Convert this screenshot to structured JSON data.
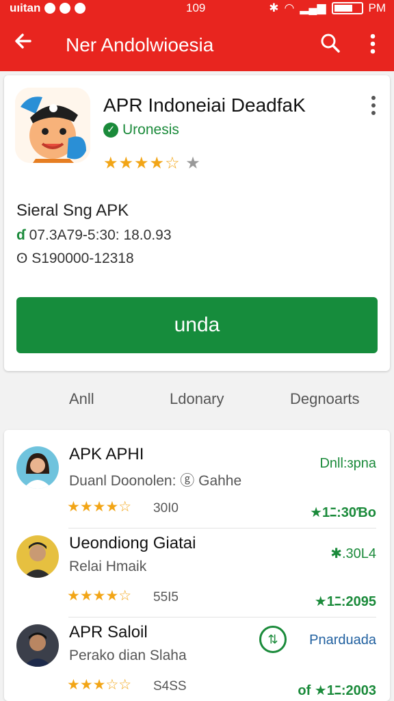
{
  "status_bar": {
    "left": "uıitan",
    "time": "109",
    "right": "PM"
  },
  "app_bar": {
    "title": "Ner Andolwioesia"
  },
  "app": {
    "name": "APR Indoneiai DeadfaK",
    "developer": "Uronesis",
    "rating": 4.5,
    "stars": "★★★★☆",
    "extra_star": "★"
  },
  "details": {
    "subtitle": "Sieral Sng APK",
    "meta1_icon": "ɗ",
    "meta1": "07.3A79-5:30: 18.0.93",
    "meta2_icon": "ʘ",
    "meta2": "S190000-12318"
  },
  "install_button": "unda",
  "tabs": [
    "Anll",
    "Ldonary",
    "Degnoarts"
  ],
  "list": [
    {
      "title": "APK APHI",
      "subtitle": "Duanl Doonolen: ⓖ Gahhe",
      "stars": "★★★★☆",
      "rating_count": "30I0",
      "right_label": "Dnll:ɜpna",
      "right_rating": "★1ﾆ:30Ɓo"
    },
    {
      "title": "Ueondiong Giatai",
      "subtitle": "Relai Hmaik",
      "stars": "★★★★☆",
      "rating_count": "55I5",
      "right_label": "✱.30L4",
      "right_rating": "★1ﾆ:2095"
    },
    {
      "title": "APR Saloil",
      "subtitle": "Perako dian Slaha",
      "stars": "★★★☆☆",
      "rating_count": "S4SS",
      "right_label": "Pnarduada",
      "right_rating": "of ★1ﾆ:2003"
    }
  ],
  "colors": {
    "primary": "#e8251f",
    "accent_green": "#168c3c",
    "star": "#f2a516"
  },
  "icons": {
    "back": "arrow-left",
    "search": "magnifier",
    "menu": "vertical-dots",
    "verified": "check-circle"
  }
}
